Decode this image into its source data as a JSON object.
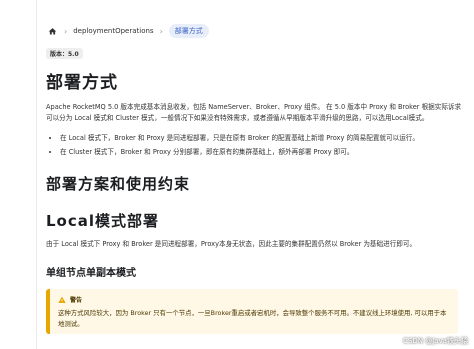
{
  "breadcrumb": {
    "home_icon": "home-icon",
    "separator": "›",
    "items": [
      "deploymentOperations",
      "部署方式"
    ]
  },
  "badge": "版本：5.0",
  "title": "部署方式",
  "intro": "Apache RocketMQ 5.0 版本完成基本消息收发，包括 NameServer、Broker、Proxy 组件。 在 5.0 版本中 Proxy 和 Broker 根据实际诉求可以分为 Local 模式和 Cluster 模式，一般情况下如果没有特殊需求，或者遵循从早期版本平滑升级的思路，可以选用Local模式。",
  "modes": [
    "在 Local 模式下，Broker 和 Proxy 是同进程部署，只是在原有 Broker 的配置基础上新增 Proxy 的简易配置就可以运行。",
    "在 Cluster 模式下，Broker 和 Proxy 分别部署，即在原有的集群基础上，额外再部署 Proxy 即可。"
  ],
  "section_heading": "部署方案和使用约束",
  "local_heading": "Local模式部署",
  "local_desc": "由于 Local 模式下 Proxy 和 Broker 是同进程部署，Proxy本身无状态，因此主要的集群配置仍然以 Broker 为基础进行即可。",
  "sub_heading": "单组节点单副本模式",
  "warning": {
    "icon": "warning-icon",
    "label": "警告",
    "text": "这种方式风险较大，因为 Broker 只有一个节点，一旦Broker重启或者宕机时，会导致整个服务不可用。不建议线上环境使用, 可以用于本地测试。",
    "accent_color": "#e6a700",
    "background_color": "#fff8e6"
  },
  "watermark": "CSDN @Java铁头猿"
}
